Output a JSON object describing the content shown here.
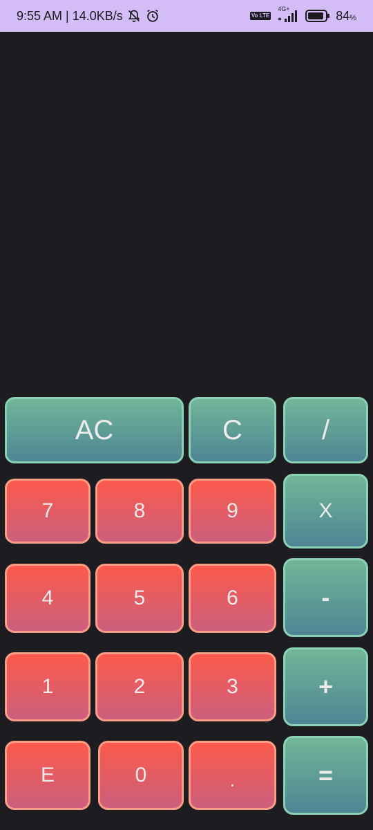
{
  "status_bar": {
    "time_speed": "9:55 AM | 14.0KB/s",
    "volte_label": "Vo LTE",
    "network_label": "4G+",
    "battery_level": "84",
    "battery_unit": "%",
    "icons": [
      "notifications-off-icon",
      "alarm-icon",
      "volte-icon",
      "signal-icon",
      "battery-icon"
    ]
  },
  "display": {
    "expression": "",
    "result": ""
  },
  "colors": {
    "background": "#1d1c20",
    "status_bar": "#d4bcf7",
    "operator_top": "#71b699",
    "operator_bottom": "#4e8593",
    "number_top": "#fc5a4b",
    "number_bottom": "#cc5f7d"
  },
  "keypad": {
    "ac": "AC",
    "c": "C",
    "divide": "/",
    "multiply": "X",
    "subtract": "-",
    "add": "+",
    "equals": "=",
    "seven": "7",
    "eight": "8",
    "nine": "9",
    "four": "4",
    "five": "5",
    "six": "6",
    "one": "1",
    "two": "2",
    "three": "3",
    "e": "E",
    "zero": "0",
    "dot": "."
  }
}
